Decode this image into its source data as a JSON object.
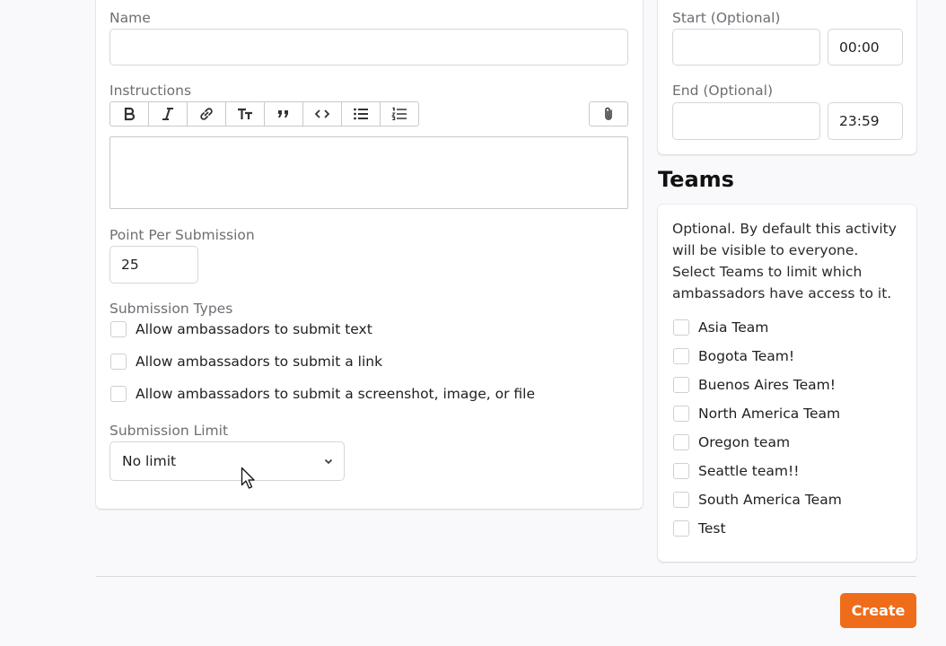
{
  "form": {
    "name_label": "Name",
    "name_value": "",
    "instructions_label": "Instructions",
    "toolbar_icons": [
      "bold-icon",
      "italic-icon",
      "link-icon",
      "heading-icon",
      "quote-icon",
      "code-icon",
      "bullet-list-icon",
      "numbered-list-icon"
    ],
    "attach_icon": "paperclip-icon",
    "points_label": "Point Per Submission",
    "points_value": "25",
    "submission_types_label": "Submission Types",
    "submission_types": [
      "Allow ambassadors to submit text",
      "Allow ambassadors to submit a link",
      "Allow ambassadors to submit a screenshot, image, or file"
    ],
    "submission_limit_label": "Submission Limit",
    "submission_limit_value": "No limit"
  },
  "schedule": {
    "start_label": "Start (Optional)",
    "start_time": "00:00",
    "end_label": "End (Optional)",
    "end_time": "23:59"
  },
  "teams": {
    "title": "Teams",
    "description": "Optional. By default this activity will be visible to everyone. Select Teams to limit which ambassadors have access to it.",
    "items": [
      "Asia Team",
      "Bogota Team!",
      "Buenos Aires Team!",
      "North America Team",
      "Oregon team",
      "Seattle team!!",
      "South America Team",
      "Test"
    ]
  },
  "actions": {
    "create_label": "Create"
  },
  "colors": {
    "accent": "#ef6c1a"
  }
}
